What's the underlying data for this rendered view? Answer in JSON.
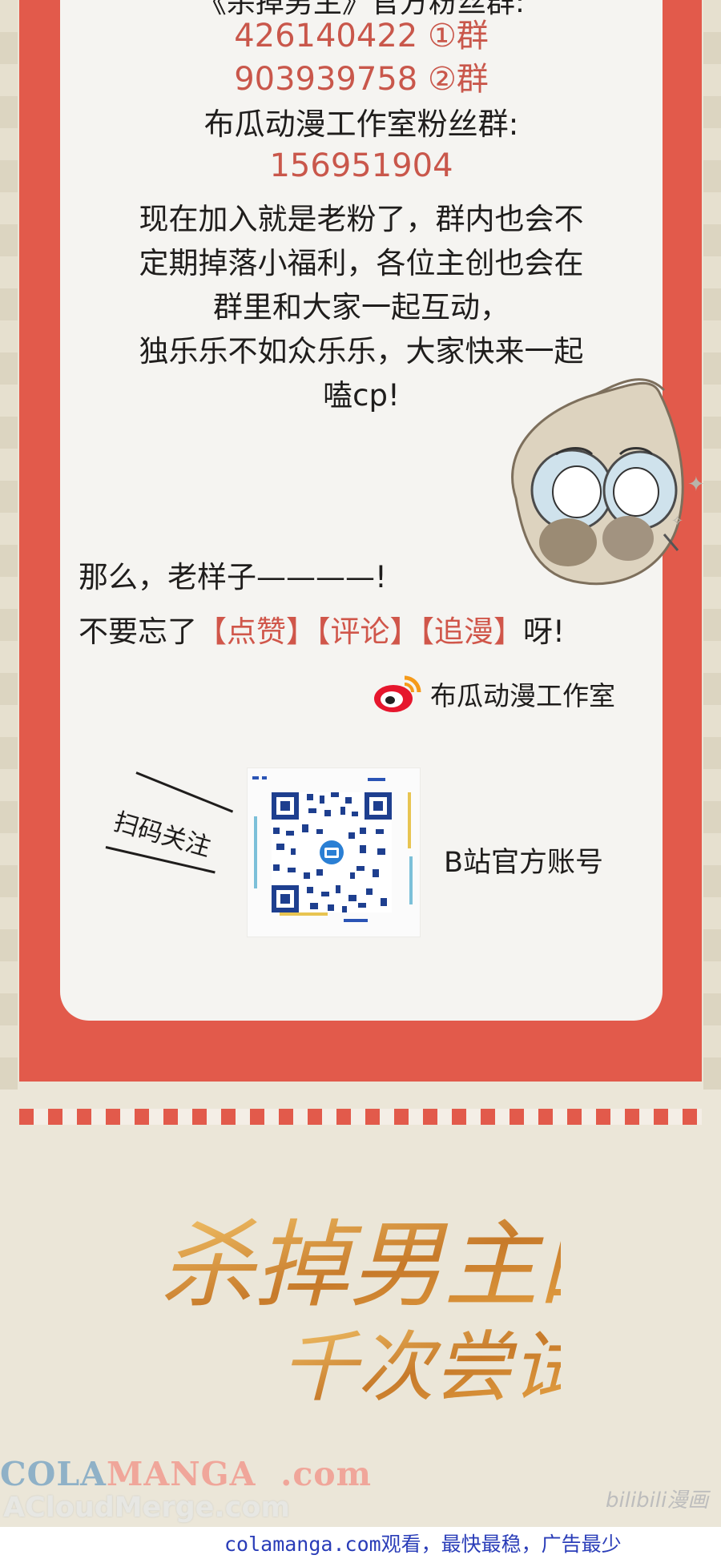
{
  "group_info": {
    "top_partial": "《杀掉男主》官方粉丝群:",
    "group1": "426140422 ①群",
    "group2": "903939758 ②群",
    "studio_group_label": "布瓜动漫工作室粉丝群:",
    "studio_group_number": "156951904"
  },
  "paragraph": [
    "现在加入就是老粉了，群内也会不",
    "定期掉落小福利，各位主创也会在",
    "群里和大家一起互动，",
    "独乐乐不如众乐乐，大家快来一起",
    "嗑cp!"
  ],
  "cta": {
    "line1": "那么，老样子————!",
    "line2_prefix": "不要忘了",
    "like": "【点赞】",
    "comment": "【评论】",
    "follow": "【追漫】",
    "line2_suffix": "呀!"
  },
  "weibo": {
    "icon": "weibo-icon",
    "name": "布瓜动漫工作室"
  },
  "qr": {
    "scan_label": "扫码关注",
    "account_label": "B站官方账号"
  },
  "title_logo": {
    "line1": "杀掉男主的",
    "line2": "千次尝试"
  },
  "watermarks": {
    "colamanga_a": "COLA",
    "colamanga_b": "MANGA",
    "colamanga_c": ".com",
    "acloud": "ACloudMerge.com",
    "bilibili": "bilibili漫画"
  },
  "footer": {
    "text": "colamanga.com观看，最快最稳，广告最少"
  },
  "colors": {
    "frame_red": "#e25a4b",
    "number_red": "#c9574b",
    "card_white": "#f5f4f1",
    "footer_blue": "#2a3db8"
  }
}
